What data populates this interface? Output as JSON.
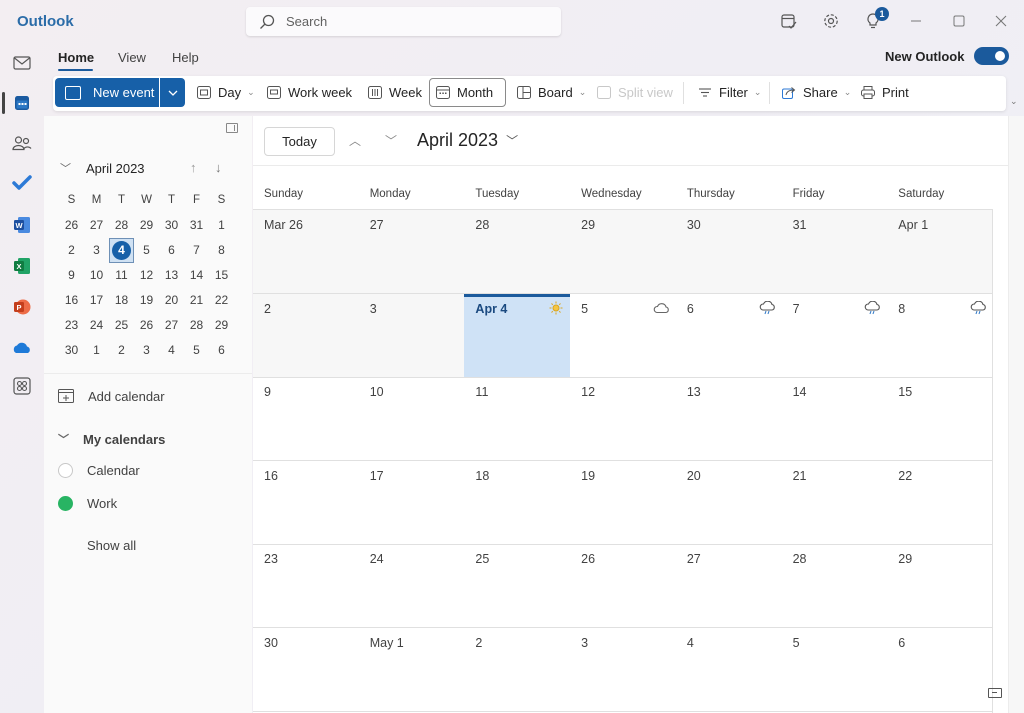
{
  "window": {
    "app_title": "Outlook",
    "search_placeholder": "Search",
    "notification_count": "1",
    "icons": [
      "calendar-check-icon",
      "gear-icon",
      "lightbulb-icon",
      "minimize-icon",
      "maximize-icon",
      "close-icon"
    ]
  },
  "rail": {
    "items": [
      "mail",
      "calendar",
      "people",
      "to-do",
      "word",
      "excel",
      "powerpoint",
      "onedrive",
      "more-apps"
    ],
    "active": "calendar"
  },
  "ribbon": {
    "tabs": [
      {
        "label": "Home",
        "active": true
      },
      {
        "label": "View",
        "active": false
      },
      {
        "label": "Help",
        "active": false
      }
    ],
    "new_outlook_label": "New Outlook",
    "new_outlook_enabled": true,
    "new_event_label": "New event",
    "buttons": {
      "day": "Day",
      "work_week": "Work week",
      "week": "Week",
      "month": "Month",
      "board": "Board",
      "split_view": "Split view",
      "filter": "Filter",
      "share": "Share",
      "print": "Print"
    },
    "selected_view": "Month"
  },
  "mini_calendar": {
    "title": "April 2023",
    "dow": [
      "S",
      "M",
      "T",
      "W",
      "T",
      "F",
      "S"
    ],
    "weeks": [
      [
        "26",
        "27",
        "28",
        "29",
        "30",
        "31",
        "1"
      ],
      [
        "2",
        "3",
        "4",
        "5",
        "6",
        "7",
        "8"
      ],
      [
        "9",
        "10",
        "11",
        "12",
        "13",
        "14",
        "15"
      ],
      [
        "16",
        "17",
        "18",
        "19",
        "20",
        "21",
        "22"
      ],
      [
        "23",
        "24",
        "25",
        "26",
        "27",
        "28",
        "29"
      ],
      [
        "30",
        "1",
        "2",
        "3",
        "4",
        "5",
        "6"
      ]
    ],
    "today": "4"
  },
  "left_pane": {
    "add_calendar": "Add calendar",
    "my_calendars": "My calendars",
    "calendars": [
      {
        "name": "Calendar",
        "checked": false
      },
      {
        "name": "Work",
        "checked": true,
        "color": "#28b463"
      }
    ],
    "show_all": "Show all"
  },
  "calendar": {
    "today_label": "Today",
    "month_title": "April 2023",
    "dow": [
      "Sunday",
      "Monday",
      "Tuesday",
      "Wednesday",
      "Thursday",
      "Friday",
      "Saturday"
    ],
    "weeks": [
      [
        {
          "label": "Mar 26",
          "other": true
        },
        {
          "label": "27",
          "other": true
        },
        {
          "label": "28",
          "other": true
        },
        {
          "label": "29",
          "other": true
        },
        {
          "label": "30",
          "other": true
        },
        {
          "label": "31",
          "other": true
        },
        {
          "label": "Apr 1",
          "other": true
        }
      ],
      [
        {
          "label": "2",
          "other": true
        },
        {
          "label": "3",
          "other": true
        },
        {
          "label": "Apr 4",
          "today": true,
          "weather": "sunny"
        },
        {
          "label": "5",
          "weather": "cloudy"
        },
        {
          "label": "6",
          "weather": "rain"
        },
        {
          "label": "7",
          "weather": "rain"
        },
        {
          "label": "8",
          "weather": "rain"
        }
      ],
      [
        {
          "label": "9"
        },
        {
          "label": "10"
        },
        {
          "label": "11"
        },
        {
          "label": "12"
        },
        {
          "label": "13"
        },
        {
          "label": "14"
        },
        {
          "label": "15"
        }
      ],
      [
        {
          "label": "16"
        },
        {
          "label": "17"
        },
        {
          "label": "18"
        },
        {
          "label": "19"
        },
        {
          "label": "20"
        },
        {
          "label": "21"
        },
        {
          "label": "22"
        }
      ],
      [
        {
          "label": "23"
        },
        {
          "label": "24"
        },
        {
          "label": "25"
        },
        {
          "label": "26"
        },
        {
          "label": "27"
        },
        {
          "label": "28"
        },
        {
          "label": "29"
        }
      ],
      [
        {
          "label": "30"
        },
        {
          "label": "May 1"
        },
        {
          "label": "2"
        },
        {
          "label": "3"
        },
        {
          "label": "4"
        },
        {
          "label": "5"
        },
        {
          "label": "6"
        }
      ]
    ]
  },
  "colors": {
    "accent": "#1760a8",
    "today_bg": "#cfe2f6",
    "title": "#2b6ca8"
  }
}
